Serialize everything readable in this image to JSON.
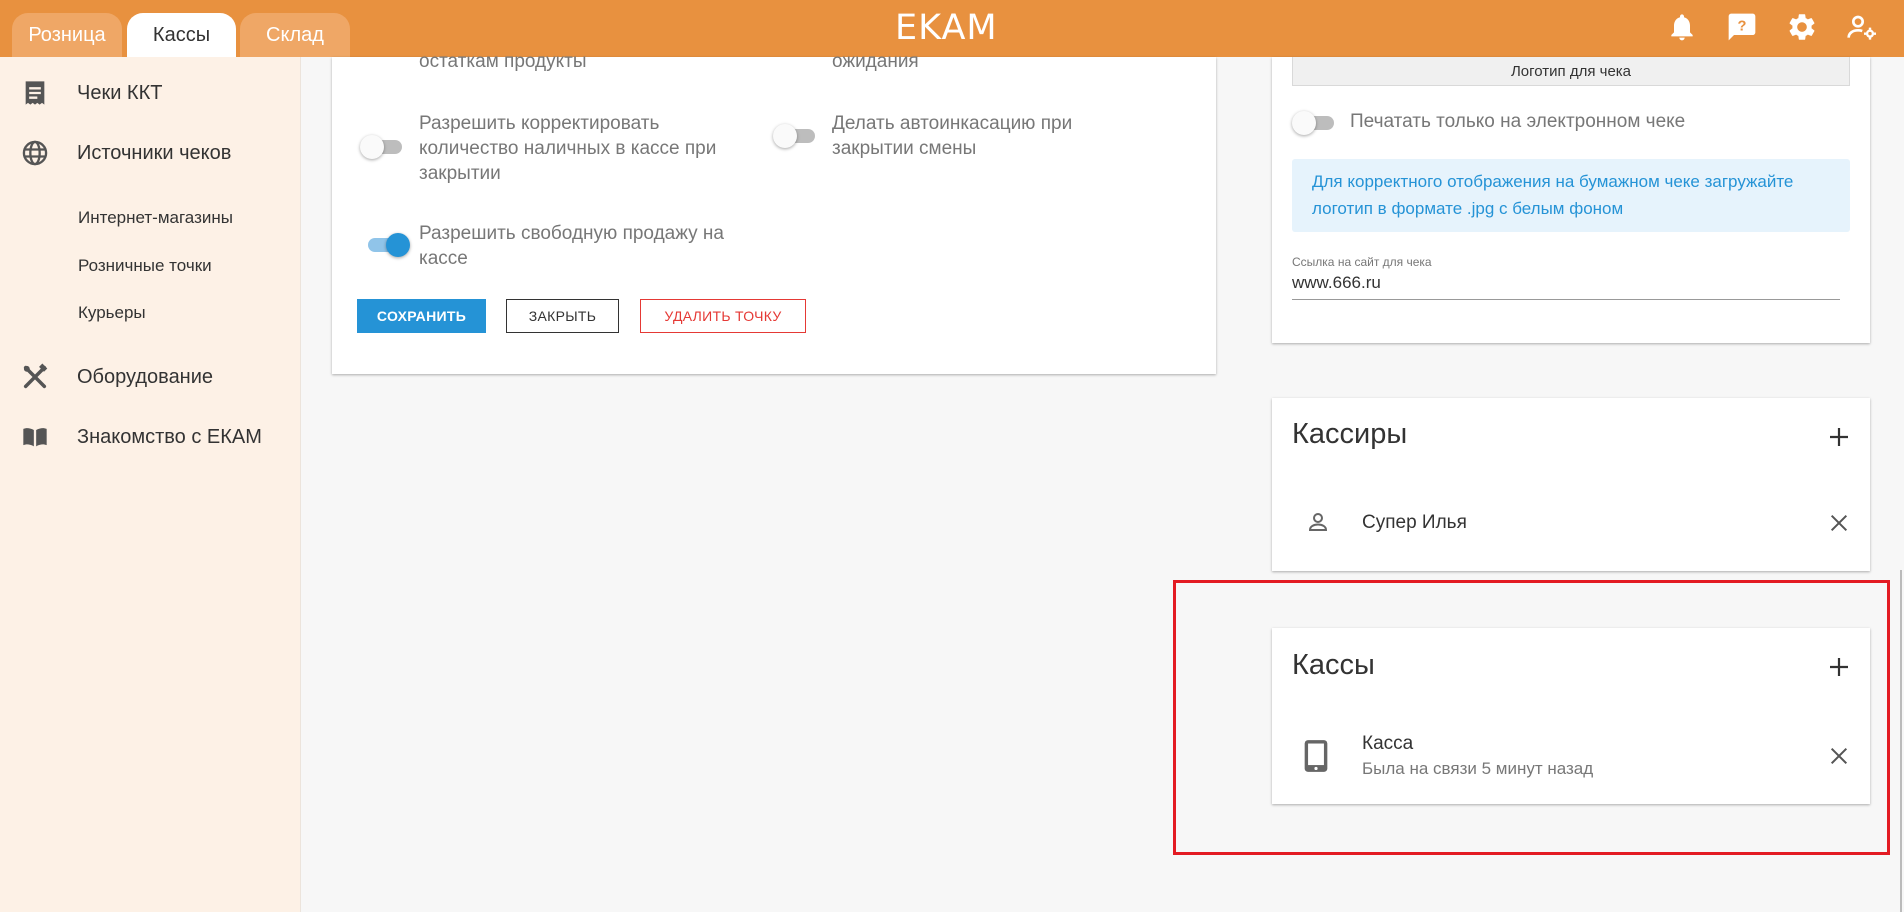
{
  "topbar": {
    "tabs": [
      {
        "label": "Розница"
      },
      {
        "label": "Кассы"
      },
      {
        "label": "Склад"
      }
    ],
    "logo": "EKAM",
    "icons": [
      "bell-icon",
      "help-chat-icon",
      "gear-icon",
      "user-settings-icon"
    ]
  },
  "sidebar": {
    "items": [
      {
        "label": "Чеки ККТ",
        "icon": "receipt-list-icon"
      },
      {
        "label": "Источники чеков",
        "icon": "globe-icon"
      },
      {
        "label": "Оборудование",
        "icon": "tools-icon"
      },
      {
        "label": "Знакомство с ЕКАМ",
        "icon": "book-icon"
      }
    ],
    "sub_items": [
      {
        "label": "Интернет-магазины"
      },
      {
        "label": "Розничные точки"
      },
      {
        "label": "Курьеры"
      }
    ]
  },
  "settings": {
    "partial_left": "остаткам продукты",
    "partial_right": "ожидания",
    "options": [
      {
        "label": "Разрешить корректировать количество наличных в кассе при закрытии",
        "on": false
      },
      {
        "label": "Делать автоинкасацию при закрытии смены",
        "on": false
      },
      {
        "label": "Разрешить свободную продажу на кассе",
        "on": true
      }
    ],
    "buttons": {
      "save": "СОХРАНИТЬ",
      "close": "ЗАКРЫТЬ",
      "delete": "УДАЛИТЬ ТОЧКУ"
    }
  },
  "receipt": {
    "logo_button": "Логотип для чека",
    "print_only_electronic": "Печатать только на электронном чеке",
    "info": "Для корректного отображения на бумажном чеке загружайте логотип в формате .jpg с белым фоном",
    "site_label": "Ссылка на сайт для чека",
    "site_value": "www.666.ru"
  },
  "cashiers": {
    "title": "Кассиры",
    "items": [
      {
        "name": "Супер Илья"
      }
    ]
  },
  "registers": {
    "title": "Кассы",
    "items": [
      {
        "name": "Касса",
        "status": "Была на связи 5 минут назад"
      }
    ]
  },
  "colors": {
    "brand": "#e8913f",
    "accent": "#2593d6",
    "danger": "#e53935",
    "highlight": "#e31b23"
  }
}
